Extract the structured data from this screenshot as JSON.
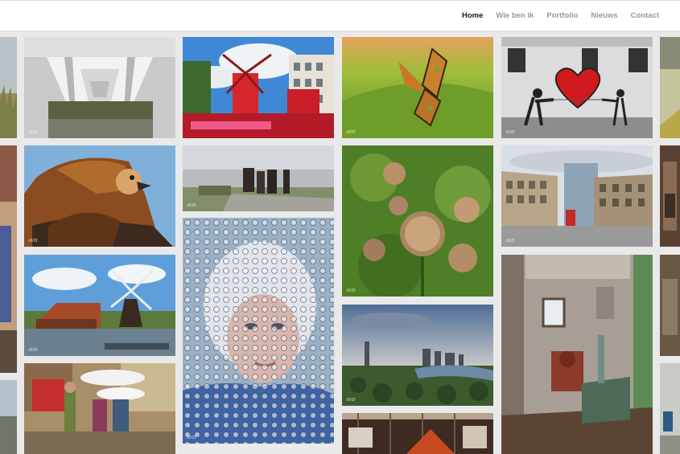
{
  "nav": {
    "items": [
      "Home",
      "Wie ben ik",
      "Portfolio",
      "Nieuws",
      "Contact"
    ],
    "active": "Home"
  },
  "watermark": "AVD",
  "colors": {
    "page_bg": "#e9e9e9",
    "nav_active": "#1c1c1c",
    "nav_inactive": "#999999"
  }
}
